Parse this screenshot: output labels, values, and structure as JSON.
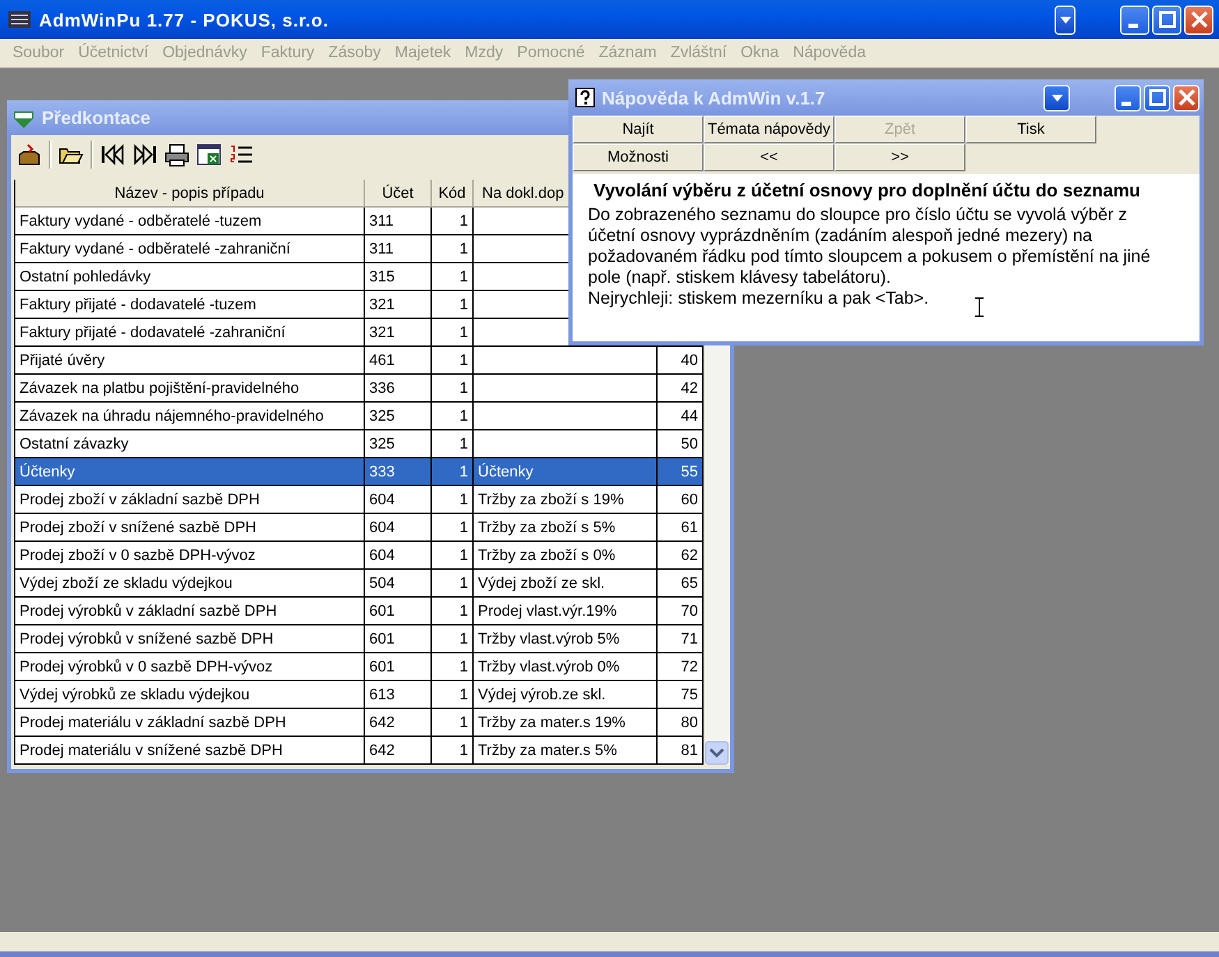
{
  "window": {
    "title": "AdmWinPu 1.77 - POKUS, s.r.o."
  },
  "menu": [
    {
      "label": "Soubor",
      "disabled": true
    },
    {
      "label": "Účetnictví",
      "disabled": true
    },
    {
      "label": "Objednávky",
      "disabled": true
    },
    {
      "label": "Faktury",
      "disabled": true
    },
    {
      "label": "Zásoby",
      "disabled": true
    },
    {
      "label": "Majetek",
      "disabled": true
    },
    {
      "label": "Mzdy",
      "disabled": true
    },
    {
      "label": "Pomocné",
      "disabled": true
    },
    {
      "label": "Záznam",
      "disabled": true
    },
    {
      "label": "Zvláštní",
      "disabled": true
    },
    {
      "label": "Okna",
      "disabled": true
    },
    {
      "label": "Nápověda",
      "disabled": true
    }
  ],
  "list_window": {
    "title": "Předkontace",
    "table": {
      "columns": [
        "Název - popis případu",
        "Účet",
        "Kód",
        "Na dokl.dop"
      ],
      "rows": [
        {
          "name": "Faktury vydané - odběratelé -tuzem",
          "account": "311",
          "code": "1",
          "selected": false
        },
        {
          "name": "Faktury vydané - odběratelé -zahraniční",
          "account": "311",
          "code": "1",
          "selected": false
        },
        {
          "name": "Ostatní pohledávky",
          "account": "315",
          "code": "1",
          "selected": false
        },
        {
          "name": "Faktury přijaté - dodavatelé -tuzem",
          "account": "321",
          "code": "1",
          "selected": false
        },
        {
          "name": "Faktury přijaté - dodavatelé -zahraniční",
          "account": "321",
          "code": "1",
          "selected": false
        },
        {
          "name": "Přijaté úvěry",
          "account": "461",
          "code": "1",
          "column_5": "40",
          "selected": false
        },
        {
          "name": "Závazek na platbu pojištění-pravidelného",
          "account": "336",
          "code": "1",
          "column_5": "42",
          "selected": false
        },
        {
          "name": "Závazek na úhradu nájemného-pravidelného",
          "account": "325",
          "code": "1",
          "column_5": "44",
          "selected": false
        },
        {
          "name": "Ostatní závazky",
          "account": "325",
          "code": "1",
          "column_5": "50",
          "selected": false
        },
        {
          "name": "Účtenky",
          "account": "333",
          "code": "1",
          "doc_text": "Účtenky",
          "column_5": "55",
          "selected": true
        },
        {
          "name": "Prodej zboží v základní sazbě DPH",
          "account": "604",
          "code": "1",
          "doc_text": "Tržby za zboží s 19%",
          "column_5": "60",
          "selected": false
        },
        {
          "name": "Prodej zboží v snížené sazbě DPH",
          "account": "604",
          "code": "1",
          "doc_text": "Tržby za zboží s 5%",
          "column_5": "61",
          "selected": false
        },
        {
          "name": "Prodej zboží v 0 sazbě DPH-vývoz",
          "account": "604",
          "code": "1",
          "doc_text": "Tržby za zboží s 0%",
          "column_5": "62",
          "selected": false
        },
        {
          "name": "Výdej zboží ze skladu výdejkou",
          "account": "504",
          "code": "1",
          "doc_text": "Výdej zboží ze skl.",
          "column_5": "65",
          "selected": false
        },
        {
          "name": "Prodej výrobků v základní sazbě DPH",
          "account": "601",
          "code": "1",
          "doc_text": "Prodej vlast.výr.19%",
          "column_5": "70",
          "selected": false
        },
        {
          "name": "Prodej výrobků v snížené sazbě DPH",
          "account": "601",
          "code": "1",
          "doc_text": "Tržby vlast.výrob 5%",
          "column_5": "71",
          "selected": false
        },
        {
          "name": "Prodej výrobků v 0 sazbě DPH-vývoz",
          "account": "601",
          "code": "1",
          "doc_text": "Tržby vlast.výrob 0%",
          "column_5": "72",
          "selected": false
        },
        {
          "name": "Výdej výrobků ze skladu výdejkou",
          "account": "613",
          "code": "1",
          "doc_text": "Výdej výrob.ze skl.",
          "column_5": "75",
          "selected": false
        },
        {
          "name": "Prodej materiálu v základní sazbě DPH",
          "account": "642",
          "code": "1",
          "doc_text": "Tržby za mater.s 19%",
          "column_5": "80",
          "selected": false
        },
        {
          "name": "Prodej materiálu v snížené sazbě DPH",
          "account": "642",
          "code": "1",
          "doc_text": "Tržby za mater.s 5%",
          "column_5": "81",
          "selected": false
        }
      ]
    }
  },
  "help_window": {
    "title": "Nápověda k AdmWin v.1.7",
    "buttons": [
      {
        "label": "Najít",
        "disabled": false
      },
      {
        "label": "Témata nápovědy",
        "disabled": false
      },
      {
        "label": "Zpět",
        "disabled": true
      },
      {
        "label": "Tisk",
        "disabled": false
      },
      {
        "label": "Možnosti",
        "disabled": false
      },
      {
        "label": "<<",
        "disabled": false
      },
      {
        "label": ">>",
        "disabled": false
      }
    ],
    "heading": "Vyvolání výběru z účetní osnovy pro doplnění účtu do seznamu",
    "paragraphs": [
      "Do zobrazeného seznamu do sloupce pro číslo účtu se vyvolá výběr z účetní osnovy vyprázdněním (zadáním alespoň jedné mezery) na požadovaném řádku pod tímto sloupcem a pokusem o přemístění na jiné pole (např. stiskem klávesy tabelátoru).",
      "Nejrychleji: stiskem mezerníku a pak <Tab>."
    ]
  }
}
